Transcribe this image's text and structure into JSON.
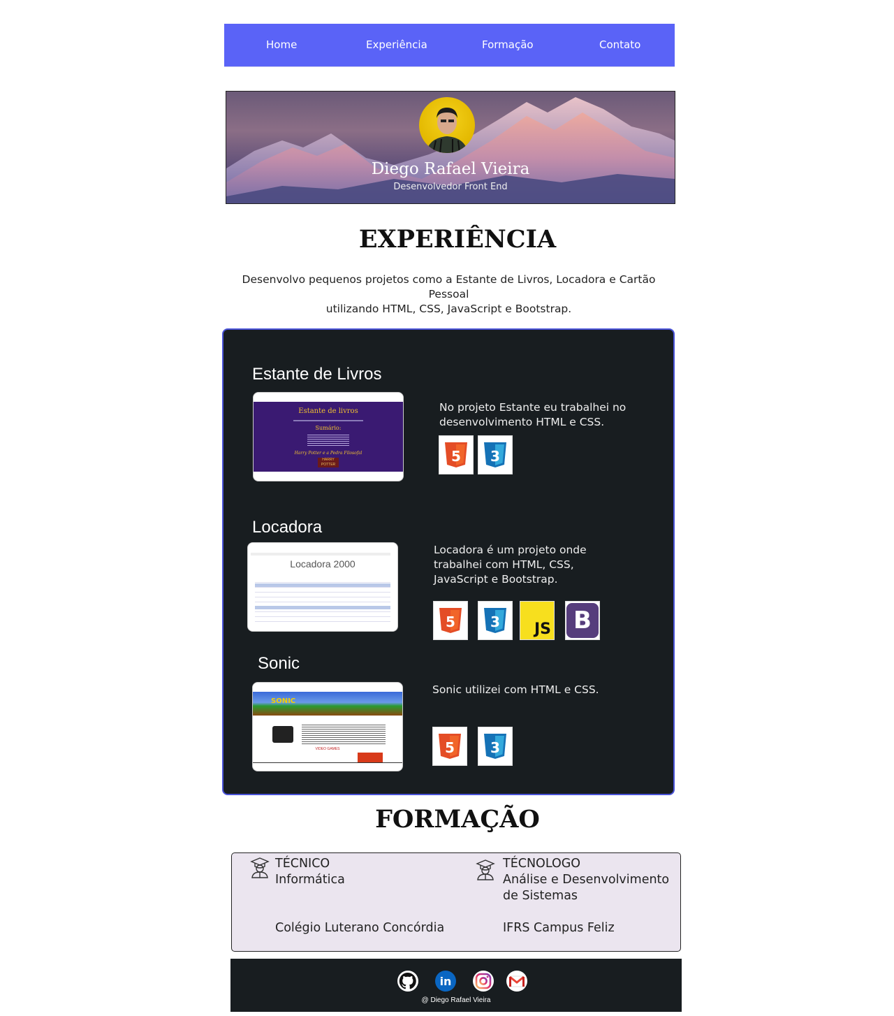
{
  "nav": {
    "home": "Home",
    "experiencia": "Experiência",
    "formacao": "Formação",
    "contato": "Contato"
  },
  "hero": {
    "name": "Diego Rafael Vieira",
    "role": "Desenvolvedor Front End"
  },
  "experience": {
    "heading": "EXPERIÊNCIA",
    "intro_line1": "Desenvolvo pequenos projetos como a Estante de Livros, Locadora e Cartão Pessoal",
    "intro_line2": "utilizando HTML, CSS, JavaScript e Bootstrap.",
    "projects": [
      {
        "title": "Estante de Livros",
        "desc_line1": "No projeto Estante eu trabalhei no",
        "desc_line2": "desenvolvimento HTML e CSS.",
        "shot": {
          "title": "Estante de livros",
          "subtitle": "Sumário:",
          "book": "Harry Potter e a Pedra Filosofal",
          "book_cover": "HARRY POTTER"
        },
        "techs": [
          "html5-icon",
          "css3-icon"
        ]
      },
      {
        "title": "Locadora",
        "desc_line1": "Locadora é um projeto onde",
        "desc_line2": "trabalhei com HTML, CSS,",
        "desc_line3": "JavaScript e Bootstrap.",
        "shot": {
          "title": "Locadora 2000"
        },
        "techs": [
          "html5-icon",
          "css3-icon",
          "javascript-icon",
          "bootstrap-icon"
        ]
      },
      {
        "title": "Sonic",
        "desc_line1": "Sonic utilizei com HTML e CSS.",
        "shot": {
          "logo": "SONIC",
          "section": "VIDEO GAMES"
        },
        "techs": [
          "html5-icon",
          "css3-icon"
        ]
      }
    ],
    "tech_labels": {
      "js": "JS",
      "bootstrap": "B",
      "html5": "5",
      "css3": "3"
    }
  },
  "formacao": {
    "heading": "FORMAÇÃO",
    "items": [
      {
        "level": "TÉCNICO",
        "course": "Informática",
        "course2": "",
        "school": "Colégio Luterano Concórdia"
      },
      {
        "level": "TÉCNOLOGO",
        "course": "Análise e Desenvolvimento",
        "course2": "de Sistemas",
        "school": "IFRS Campus Feliz"
      }
    ]
  },
  "footer": {
    "icons": [
      "github-icon",
      "linkedin-icon",
      "instagram-icon",
      "gmail-icon"
    ],
    "linkedin_label": "in",
    "caption": "@ Diego Rafael Vieira"
  },
  "colors": {
    "nav_bg": "#5a63f7",
    "panel_bg": "#181d20",
    "panel_border": "#4a53d8",
    "formacao_bg": "#ebe5ef",
    "html5": "#e44d26",
    "css3": "#1572b6",
    "javascript": "#f7df1e",
    "bootstrap": "#563d7c"
  }
}
